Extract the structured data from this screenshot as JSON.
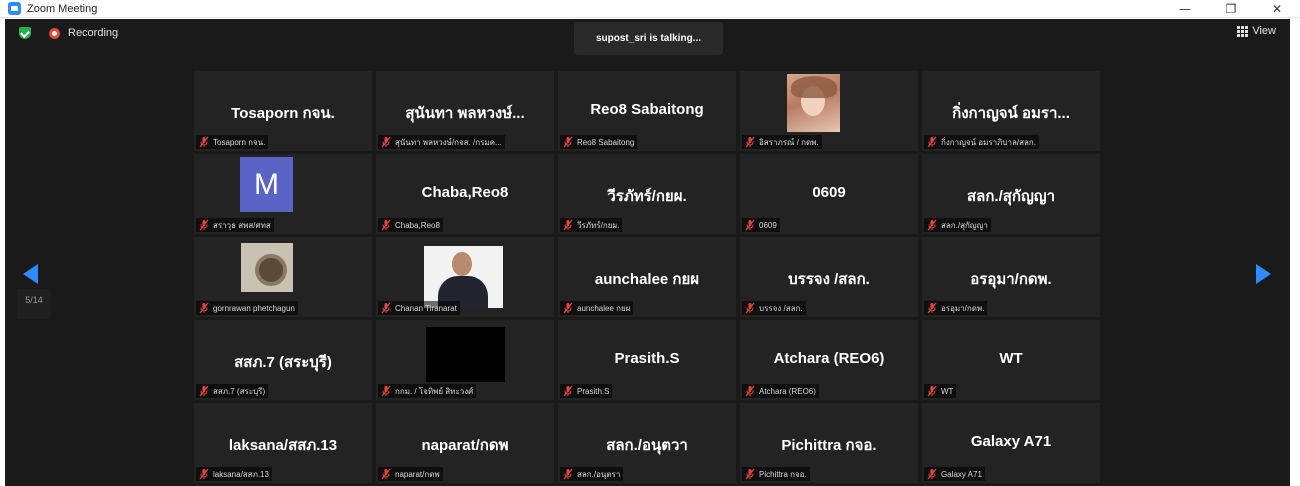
{
  "window": {
    "title": "Zoom Meeting",
    "minimize": "—",
    "restore": "❐",
    "close": "✕"
  },
  "toolbar": {
    "recording": "Recording",
    "view": "View"
  },
  "banner": {
    "talking": "supost_sri is talking..."
  },
  "pager": {
    "page": "5/14"
  },
  "colors": {
    "accent": "#2d8cff",
    "background": "#1a1a1a",
    "tile": "#232323",
    "mute_red": "#e8453c"
  },
  "tiles": [
    {
      "name": "Tosaporn กจน.",
      "label": "Tosaporn กจน."
    },
    {
      "name": "สุนันทา พลหวงษ์...",
      "label": "สุนันทา พลหวงษ์/กจส. /กรมค..."
    },
    {
      "name": "Reo8 Sabaitong",
      "label": "Reo8 Sabaitong"
    },
    {
      "label": "อิสราภรณ์ / กดพ."
    },
    {
      "name": "กิ่งกาญจน์ อมรา...",
      "label": "กิ่งกาญจน์ อมราภิบาล/สลก."
    },
    {
      "avatar": "M",
      "label": "สราวุธ สพส/ศทส"
    },
    {
      "name": "Chaba,Reo8",
      "label": "Chaba,Reo8"
    },
    {
      "name": "วีรภัทร์/กยผ.",
      "label": "วีรภัทร์/กยผ."
    },
    {
      "name": "0609",
      "label": "0609"
    },
    {
      "name": "สลก./สุกัญญา",
      "label": "สลก./สุกัญญา"
    },
    {
      "label": "gornrawan phetchagun"
    },
    {
      "label": "Chanan Tiranarat"
    },
    {
      "name": "aunchalee กยผ",
      "label": "aunchalee กยผ"
    },
    {
      "name": "บรรจง /สลก.",
      "label": "บรรจง /สลก."
    },
    {
      "name": "อรอุมา/กดพ.",
      "label": "อรอุมา/กดพ."
    },
    {
      "name": "สสภ.7 (สระบุรี)",
      "label": "สสภ.7 (สระบุรี)"
    },
    {
      "label": "กกม. / โจทิพย์ สิทะวงศ์"
    },
    {
      "name": "Prasith.S",
      "label": "Prasith.S"
    },
    {
      "name": "Atchara (REO6)",
      "label": "Atchara (REO6)"
    },
    {
      "name": "WT",
      "label": "WT"
    },
    {
      "name": "laksana/สสภ.13",
      "label": "laksana/สสภ.13"
    },
    {
      "name": "naparat/กดพ",
      "label": "naparat/กดพ"
    },
    {
      "name": "สลก./อนุตวา",
      "label": "สลก./อนุตรา"
    },
    {
      "name": "Pichittra กจอ.",
      "label": "Pichittra กจอ."
    },
    {
      "name": "Galaxy A71",
      "label": "Galaxy A71"
    }
  ]
}
